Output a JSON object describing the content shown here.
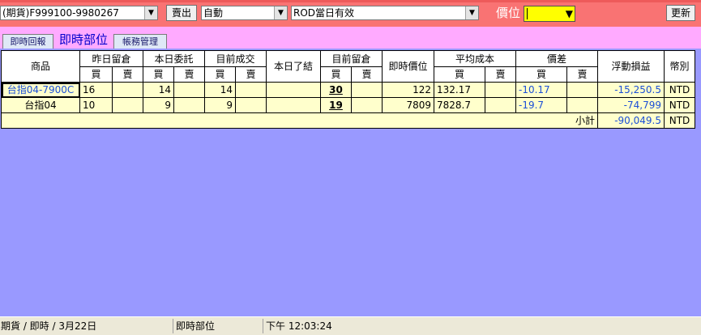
{
  "toolbar": {
    "account_value": "(期貨)F999100-9980267",
    "side_button": "賣出",
    "mode_value": "自動",
    "order_type_value": "ROD當日有效",
    "price_label": "價位",
    "refresh_button": "更新"
  },
  "tabs": [
    {
      "label": "即時回報",
      "active": false
    },
    {
      "label": "即時部位",
      "active": true
    },
    {
      "label": "帳務管理",
      "active": false
    }
  ],
  "table": {
    "headers": {
      "product": "商品",
      "prev_position": "昨日留倉",
      "today_order": "本日委託",
      "current_filled": "目前成交",
      "today_closed": "本日了結",
      "current_position": "目前留倉",
      "last_price": "即時價位",
      "avg_cost": "平均成本",
      "price_diff": "價差",
      "floating_pl": "浮動損益",
      "currency": "幣別",
      "buy": "買",
      "sell": "賣"
    },
    "rows": [
      {
        "product": "台指04-7900C",
        "prev_buy": "16",
        "prev_sell": "",
        "order_buy": "14",
        "order_sell": "",
        "filled_buy": "14",
        "filled_sell": "",
        "closed": "",
        "pos_buy": "30",
        "pos_sell": "",
        "last_price": "122",
        "avg_buy": "132.17",
        "avg_sell": "",
        "diff_buy": "-10.17",
        "diff_sell": "",
        "floating_pl": "-15,250.5",
        "currency": "NTD"
      },
      {
        "product": "台指04",
        "prev_buy": "10",
        "prev_sell": "",
        "order_buy": "9",
        "order_sell": "",
        "filled_buy": "9",
        "filled_sell": "",
        "closed": "",
        "pos_buy": "19",
        "pos_sell": "",
        "last_price": "7809",
        "avg_buy": "7828.7",
        "avg_sell": "",
        "diff_buy": "-19.7",
        "diff_sell": "",
        "floating_pl": "-74,799",
        "currency": "NTD"
      }
    ],
    "subtotal": {
      "label": "小計",
      "floating_pl": "-90,049.5",
      "currency": "NTD"
    }
  },
  "status": {
    "segment1": "期貨 / 即時 / 3月22日",
    "segment2": "即時部位",
    "segment3": "下午 12:03:24"
  },
  "colors": {
    "top_bar": "#f97373",
    "tab_strip": "#ffaaff",
    "grid_background": "#ffffcc",
    "workspace": "#9999ff",
    "highlight_text": "#1c4fd6"
  }
}
